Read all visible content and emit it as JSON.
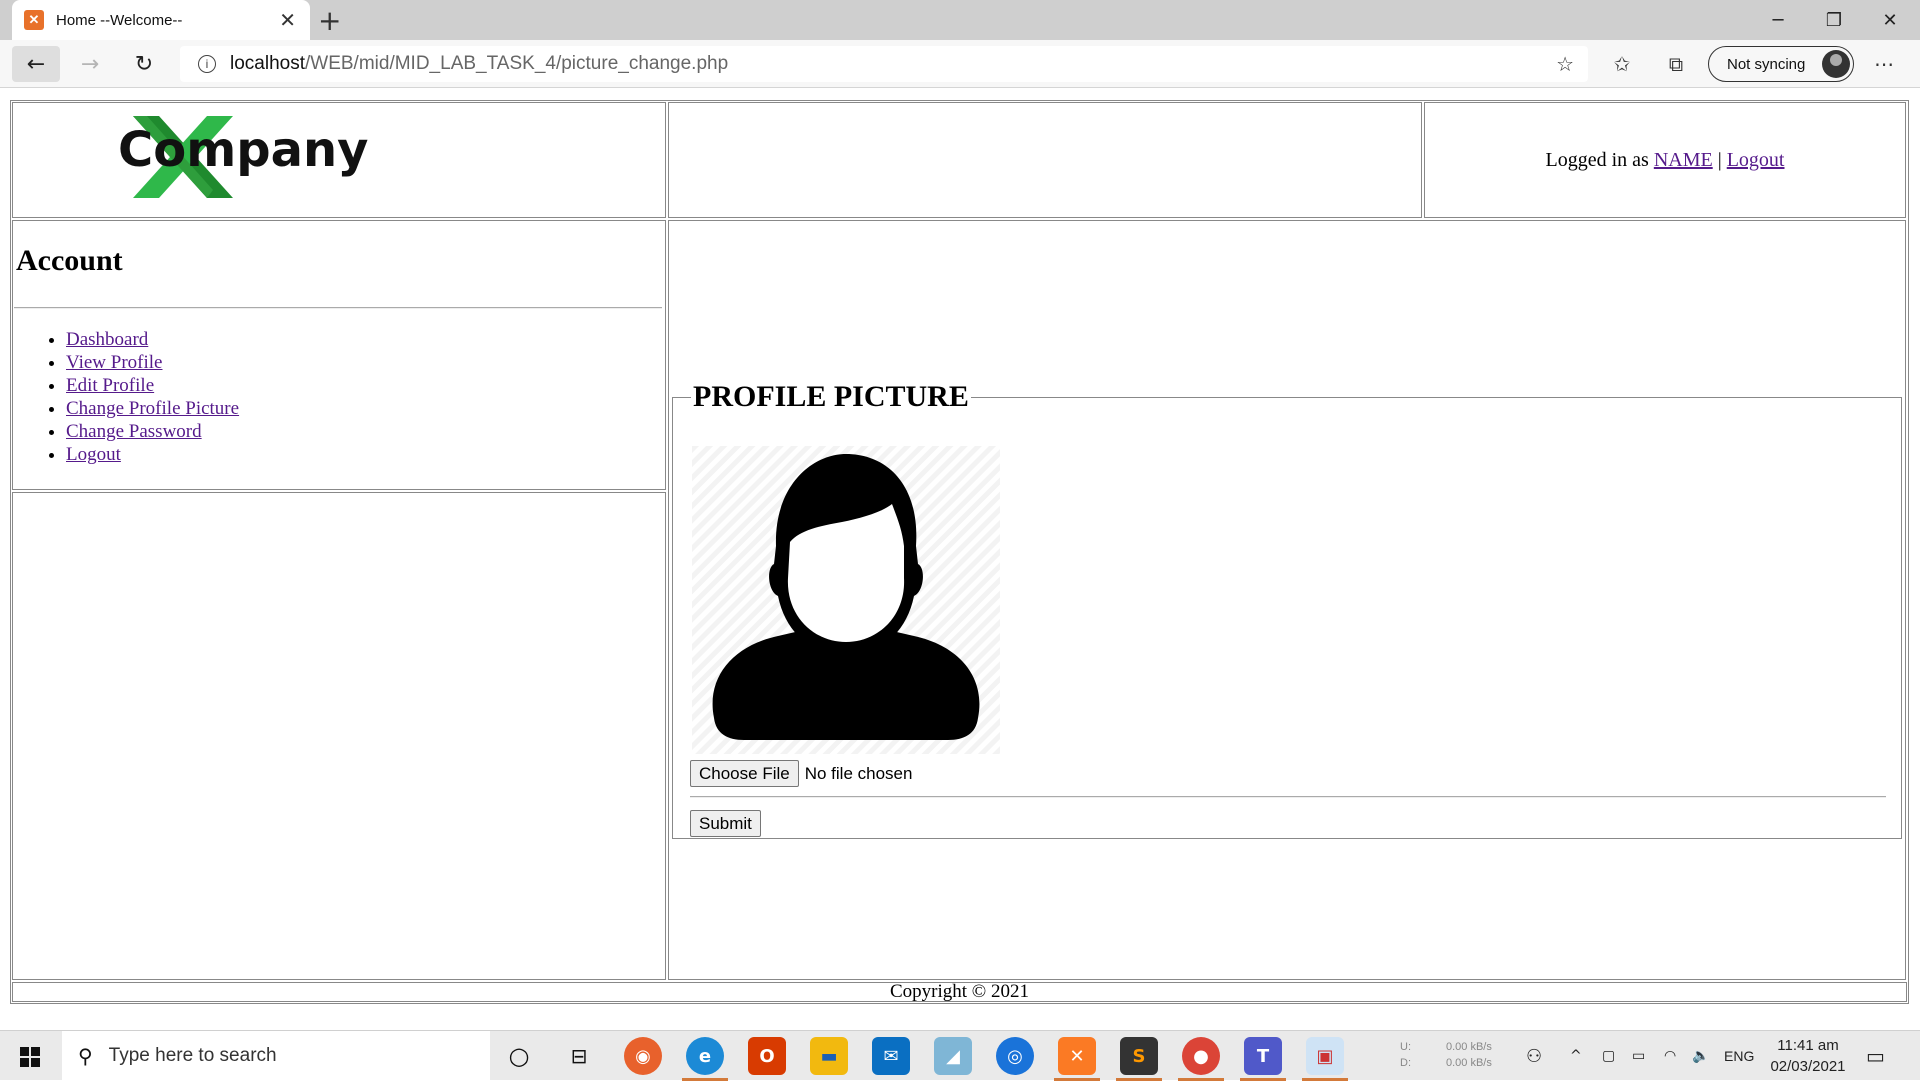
{
  "browser": {
    "tab_title": "Home --Welcome--",
    "tab_favicon": "෴",
    "url_host": "localhost",
    "url_path": "/WEB/mid/MID_LAB_TASK_4/picture_change.php",
    "sync_label": "Not syncing"
  },
  "header": {
    "logo_text": "Company",
    "logged_in_prefix": "Logged in as ",
    "user_name": "NAME",
    "separator": " | ",
    "logout_link": "Logout"
  },
  "sidebar": {
    "title": "Account",
    "items": [
      {
        "label": "Dashboard"
      },
      {
        "label": "View Profile"
      },
      {
        "label": "Edit Profile"
      },
      {
        "label": "Change Profile Picture"
      },
      {
        "label": "Change Password"
      },
      {
        "label": "Logout"
      }
    ]
  },
  "main": {
    "legend": "PROFILE PICTURE",
    "choose_file_label": "Choose File",
    "no_file_text": "No file chosen",
    "submit_label": "Submit"
  },
  "footer": {
    "copyright": "Copyright © 2021"
  },
  "taskbar": {
    "search_placeholder": "Type here to search",
    "net_up_label": "U:",
    "net_down_label": "D:",
    "net_up": "0.00 kB/s",
    "net_down": "0.00 kB/s",
    "language": "ENG",
    "time": "11:41 am",
    "date": "02/03/2021"
  }
}
